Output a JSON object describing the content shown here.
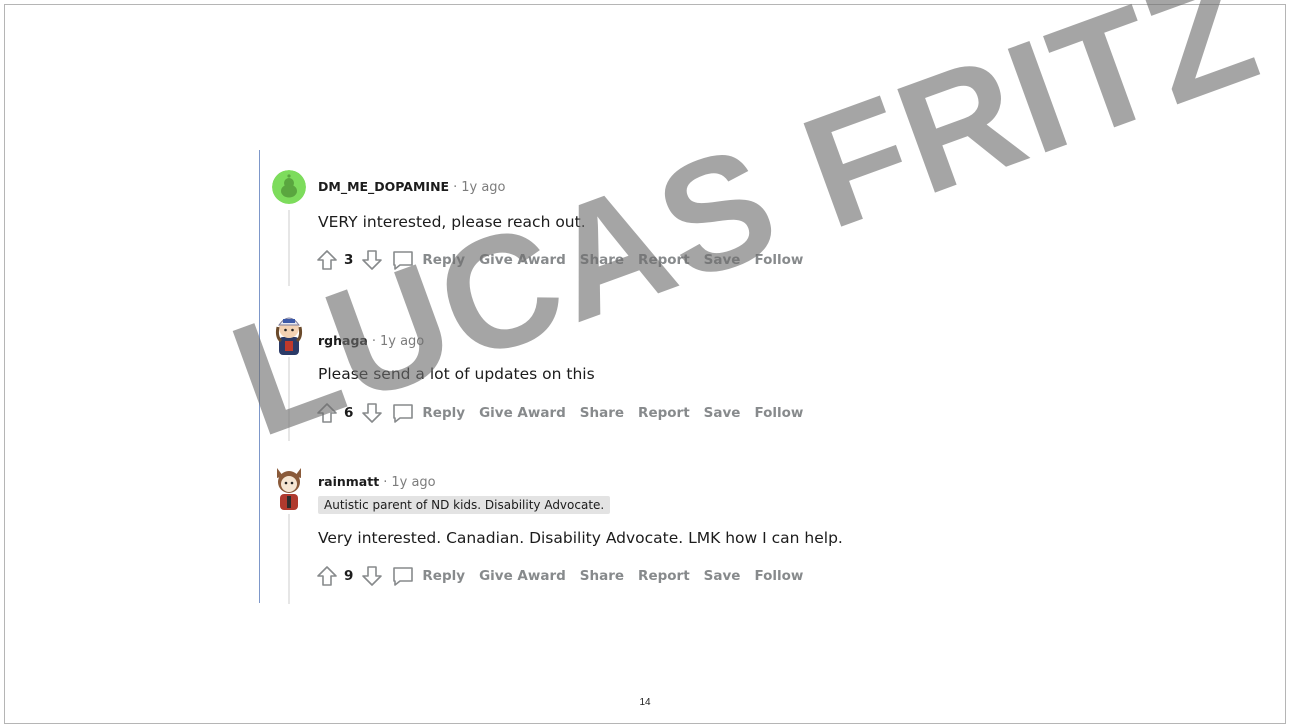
{
  "comments": [
    {
      "username": "DM_ME_DOPAMINE",
      "separator": "·",
      "time": "1y ago",
      "flair": "",
      "body": "VERY interested, please reach out.",
      "score": "3"
    },
    {
      "username": "rghaga",
      "separator": "·",
      "time": "1y ago",
      "flair": "",
      "body": "Please send a lot of updates on this",
      "score": "6"
    },
    {
      "username": "rainmatt",
      "separator": "·",
      "time": "1y ago",
      "flair": "Autistic parent of ND kids. Disability Advocate.",
      "body": "Very interested. Canadian. Disability Advocate. LMK how I can help.",
      "score": "9"
    }
  ],
  "actions": {
    "reply": "Reply",
    "give_award": "Give Award",
    "share": "Share",
    "report": "Report",
    "save": "Save",
    "follow": "Follow"
  },
  "icons": {
    "upvote": "arrow-up-icon",
    "downvote": "arrow-down-icon",
    "reply": "speech-bubble-icon"
  },
  "colors": {
    "avatar_green": "#7ddc5c",
    "thread_line": "#7d97c9",
    "action_text": "#878a8c"
  },
  "watermark": "LUCAS FRITZ",
  "page_number": "14"
}
